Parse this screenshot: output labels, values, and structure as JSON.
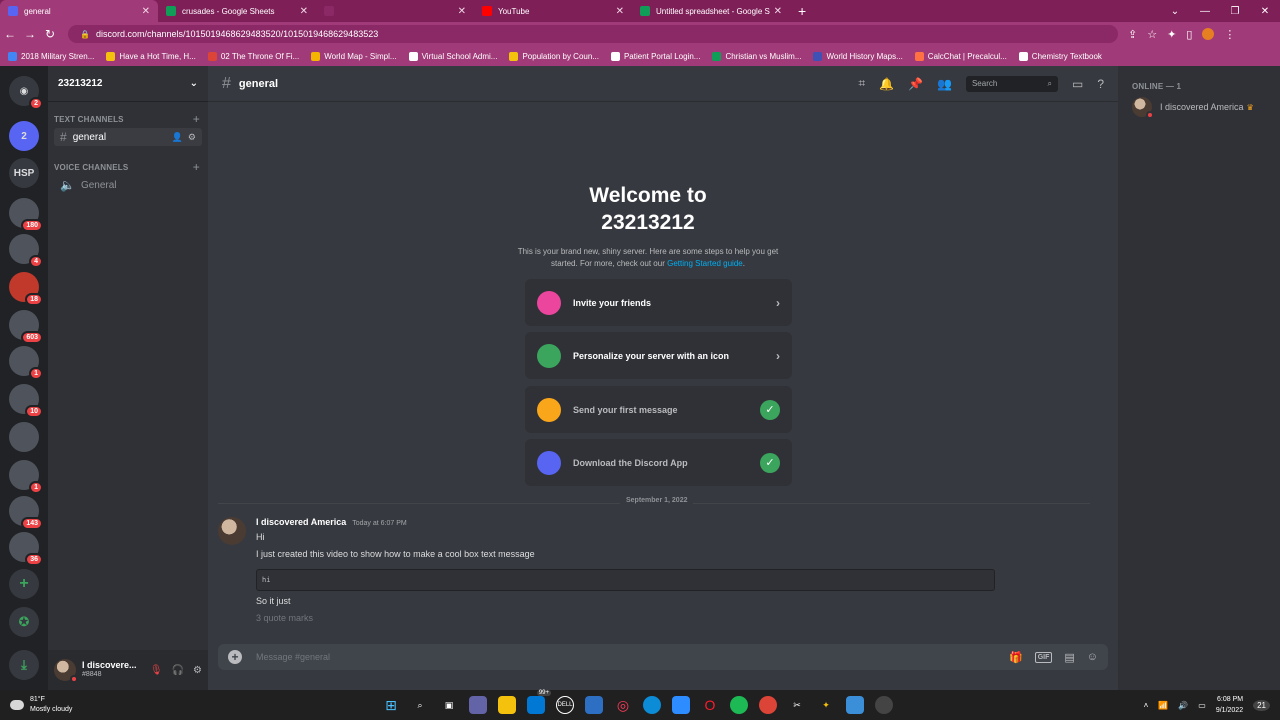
{
  "browser": {
    "tabs": [
      {
        "label": "general",
        "active": true,
        "color": "#5865f2"
      },
      {
        "label": "crusades - Google Sheets",
        "active": false,
        "color": "#0f9d58"
      },
      {
        "label": "",
        "active": false,
        "color": "#7e1f58"
      },
      {
        "label": "YouTube",
        "active": false,
        "color": "#ff0000"
      },
      {
        "label": "Untitled spreadsheet - Google Sh",
        "active": false,
        "color": "#0f9d58"
      }
    ],
    "url": "discord.com/channels/1015019468629483520/1015019468629483523",
    "bookmarks": [
      {
        "label": "2018 Military Stren...",
        "color": "#4285f4"
      },
      {
        "label": "Have a Hot Time, H...",
        "color": "#f4c20d"
      },
      {
        "label": "02 The Throne Of Fi...",
        "color": "#db4437"
      },
      {
        "label": "World Map - Simpl...",
        "color": "#f4b400"
      },
      {
        "label": "Virtual School Admi...",
        "color": "#ffffff"
      },
      {
        "label": "Population by Coun...",
        "color": "#f4c20d"
      },
      {
        "label": "Patient Portal Login...",
        "color": "#ffffff"
      },
      {
        "label": "Christian vs Muslim...",
        "color": "#0f9d58"
      },
      {
        "label": "World History Maps...",
        "color": "#3f51b5"
      },
      {
        "label": "CalcChat | Precalcul...",
        "color": "#ff7043"
      },
      {
        "label": "Chemistry Textbook",
        "color": "#ffffff"
      }
    ]
  },
  "guilds": [
    {
      "label": "",
      "badge": "2",
      "color": "#36393f"
    },
    {
      "label": "2",
      "badge": "",
      "color": "#5865f2"
    },
    {
      "label": "HSP",
      "badge": "",
      "color": "#36393f"
    },
    {
      "label": "",
      "badge": "180",
      "color": "#4f545c"
    },
    {
      "label": "",
      "badge": "4",
      "color": "#4f545c"
    },
    {
      "label": "",
      "badge": "18",
      "color": "#c0392b"
    },
    {
      "label": "",
      "badge": "603",
      "color": "#4f545c"
    },
    {
      "label": "",
      "badge": "1",
      "color": "#4f545c"
    },
    {
      "label": "",
      "badge": "10",
      "color": "#4f545c"
    },
    {
      "label": "",
      "badge": "",
      "color": "#4f545c"
    },
    {
      "label": "",
      "badge": "1",
      "color": "#4f545c"
    },
    {
      "label": "",
      "badge": "143",
      "color": "#4f545c"
    },
    {
      "label": "",
      "badge": "36",
      "color": "#4f545c"
    }
  ],
  "server": {
    "name": "23213212",
    "text_category": "TEXT CHANNELS",
    "voice_category": "VOICE CHANNELS",
    "text_channel": "general",
    "voice_channel": "General"
  },
  "user": {
    "name": "I discovere...",
    "tag": "#8848"
  },
  "channel_header": {
    "name": "general",
    "search_placeholder": "Search"
  },
  "welcome": {
    "title_line1": "Welcome to",
    "title_line2": "23213212",
    "desc": "This is your brand new, shiny server. Here are some steps to help you get started. For more, check out our",
    "link": "Getting Started guide",
    "link_after": "."
  },
  "cards": [
    {
      "label": "Invite your friends",
      "done": false,
      "color": "#eb459e"
    },
    {
      "label": "Personalize your server with an icon",
      "done": false,
      "color": "#3ba55d"
    },
    {
      "label": "Send your first message",
      "done": true,
      "color": "#faa61a"
    },
    {
      "label": "Download the Discord App",
      "done": true,
      "color": "#5865f2"
    }
  ],
  "date_divider": "September 1, 2022",
  "message": {
    "author": "I discovered America",
    "time": "Today at 6:07 PM",
    "line1": "Hi",
    "line2": "I just created this video to show how to make a cool box text message",
    "code": "hi",
    "line3": "So it just",
    "line4": "3 quote marks"
  },
  "composer": {
    "placeholder": "Message #general",
    "gif_label": "GIF"
  },
  "members": {
    "header": "ONLINE — 1",
    "name": "I discovered America"
  },
  "taskbar": {
    "temp": "81°F",
    "weather": "Mostly cloudy",
    "time": "6:08 PM",
    "date": "9/1/2022",
    "badge": "99+"
  }
}
